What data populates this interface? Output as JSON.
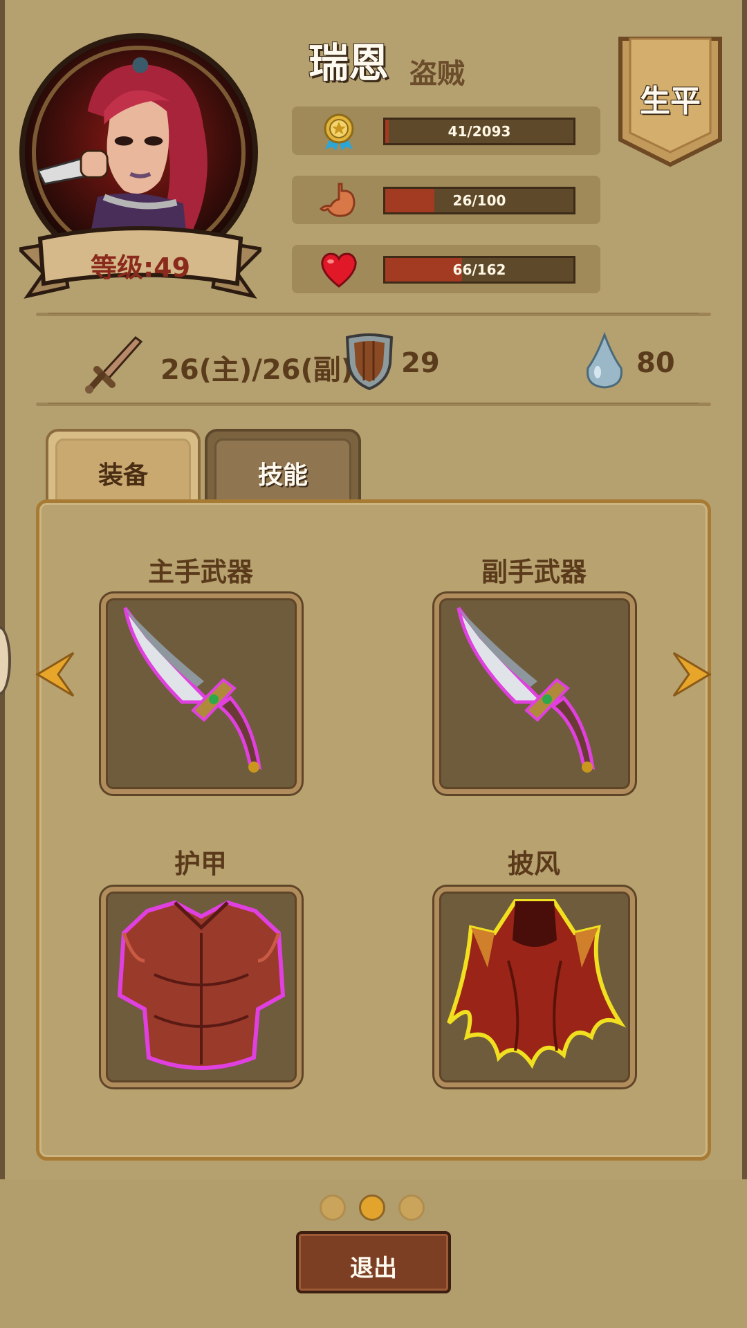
{
  "character": {
    "name": "瑞恩",
    "class": "盗贼",
    "level_text": "等级:49"
  },
  "stats": {
    "experience": {
      "icon": "medal-icon",
      "text": "41/2093",
      "fraction": 0.0196
    },
    "hunger": {
      "icon": "stomach-icon",
      "text": "26/100",
      "fraction": 0.26
    },
    "health": {
      "icon": "heart-icon",
      "text": "66/162",
      "fraction": 0.407
    }
  },
  "biography_label": "生平",
  "combat": {
    "attack": {
      "icon": "sword-icon",
      "text": "26(主)/26(副)"
    },
    "defense": {
      "icon": "shield-icon",
      "text": "29"
    },
    "mana": {
      "icon": "water-drop-icon",
      "text": "80"
    }
  },
  "tabs": [
    {
      "label": "装备",
      "active": true
    },
    {
      "label": "技能",
      "active": false
    }
  ],
  "equipment": {
    "main_hand": {
      "label": "主手武器",
      "item": "dagger-icon",
      "rarity_color": "#e040e0"
    },
    "off_hand": {
      "label": "副手武器",
      "item": "dagger-icon",
      "rarity_color": "#e040e0"
    },
    "armor": {
      "label": "护甲",
      "item": "chest-armor-icon",
      "rarity_color": "#e040e0"
    },
    "cloak": {
      "label": "披风",
      "item": "cloak-icon",
      "rarity_color": "#f0e020"
    }
  },
  "pagination": {
    "pages": 3,
    "current": 2
  },
  "exit_label": "退出",
  "colors": {
    "background": "#b5a06f",
    "bar_fill": "#a33a22",
    "accent": "#e2a42c"
  }
}
